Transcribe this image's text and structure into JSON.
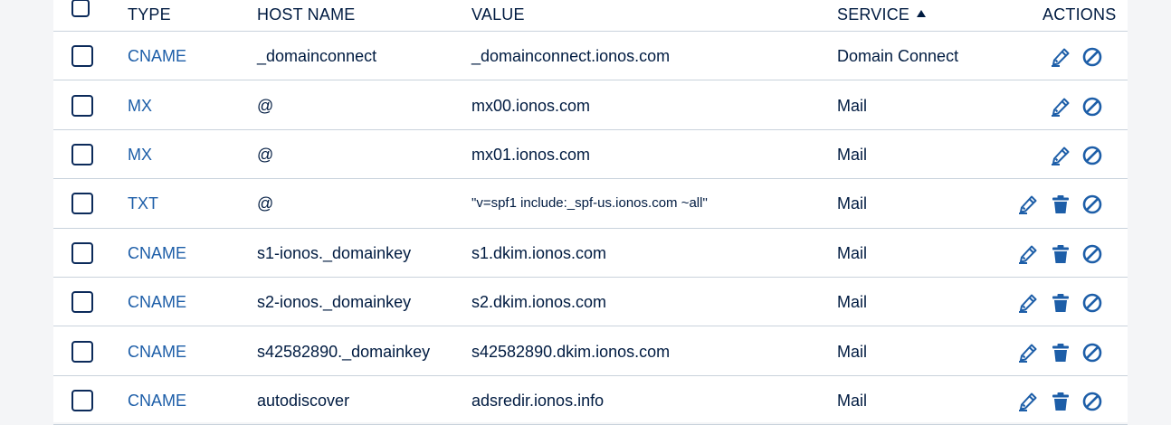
{
  "columns": {
    "type": "TYPE",
    "host": "HOST NAME",
    "value": "VALUE",
    "service": "SERVICE",
    "actions": "ACTIONS"
  },
  "sort": {
    "column": "service",
    "direction": "ascending"
  },
  "colors": {
    "accent": "#1d5ea8",
    "text": "#001b41",
    "divider": "#c9d2dc"
  },
  "records": [
    {
      "type": "CNAME",
      "host": "_domainconnect",
      "value": "_domainconnect.ionos.com",
      "service": "Domain Connect",
      "actions": [
        "edit-icon",
        "disable-icon"
      ]
    },
    {
      "type": "MX",
      "host": "@",
      "value": "mx00.ionos.com",
      "service": "Mail",
      "actions": [
        "edit-icon",
        "disable-icon"
      ]
    },
    {
      "type": "MX",
      "host": "@",
      "value": "mx01.ionos.com",
      "service": "Mail",
      "actions": [
        "edit-icon",
        "disable-icon"
      ]
    },
    {
      "type": "TXT",
      "host": "@",
      "value": "\"v=spf1 include:_spf-us.ionos.com ~all\"",
      "service": "Mail",
      "actions": [
        "edit-icon",
        "delete-icon",
        "disable-icon"
      ]
    },
    {
      "type": "CNAME",
      "host": "s1-ionos._domainkey",
      "value": "s1.dkim.ionos.com",
      "service": "Mail",
      "actions": [
        "edit-icon",
        "delete-icon",
        "disable-icon"
      ]
    },
    {
      "type": "CNAME",
      "host": "s2-ionos._domainkey",
      "value": "s2.dkim.ionos.com",
      "service": "Mail",
      "actions": [
        "edit-icon",
        "delete-icon",
        "disable-icon"
      ]
    },
    {
      "type": "CNAME",
      "host": "s42582890._domainkey",
      "value": "s42582890.dkim.ionos.com",
      "service": "Mail",
      "actions": [
        "edit-icon",
        "delete-icon",
        "disable-icon"
      ]
    },
    {
      "type": "CNAME",
      "host": "autodiscover",
      "value": "adsredir.ionos.info",
      "service": "Mail",
      "actions": [
        "edit-icon",
        "delete-icon",
        "disable-icon"
      ]
    }
  ]
}
